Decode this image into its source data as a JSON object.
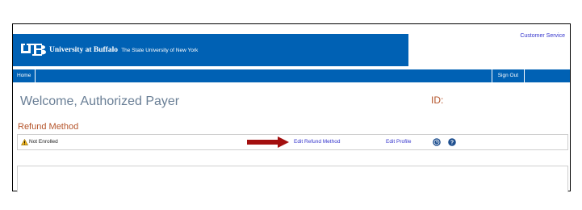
{
  "header": {
    "brand_name": "University at Buffalo",
    "brand_subtitle": "The State University of New York",
    "customer_service_label": "Customer Service",
    "banner_color": "#0061b4"
  },
  "nav": {
    "home_label": "Home",
    "signout_label": "Sign Out"
  },
  "main": {
    "welcome_text": "Welcome, Authorized Payer",
    "id_label": "ID:",
    "section_title": "Refund Method",
    "refund_row": {
      "status_text": "Not Enrolled",
      "status_icon": "warning-icon",
      "edit_refund_label": "Edit Refund Method",
      "edit_profile_label": "Edit Profile",
      "clock_icon": "clock-icon",
      "help_icon": "help-icon",
      "annotation_arrow_color": "#a30f0f"
    }
  },
  "colors": {
    "accent_orange": "#b5542a",
    "link": "#3333cc",
    "welcome_gray_blue": "#6a7f96"
  }
}
